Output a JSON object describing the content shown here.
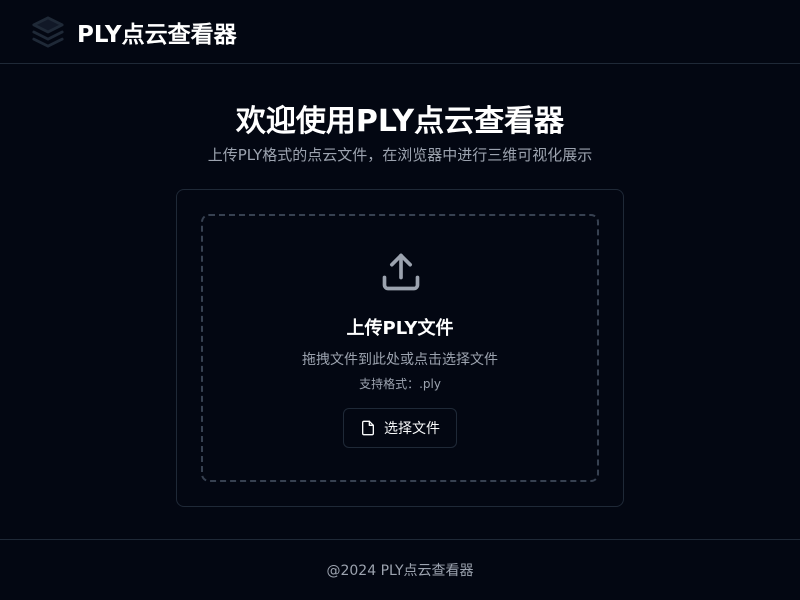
{
  "header": {
    "logo_icon": "layers-icon",
    "title": "PLY点云查看器"
  },
  "main": {
    "welcome_title": "欢迎使用PLY点云查看器",
    "welcome_subtitle": "上传PLY格式的点云文件，在浏览器中进行三维可视化展示"
  },
  "upload": {
    "icon": "upload-icon",
    "title": "上传PLY文件",
    "hint": "拖拽文件到此处或点击选择文件",
    "formats": "支持格式：.ply",
    "button_icon": "file-icon",
    "button_label": "选择文件"
  },
  "footer": {
    "text": "@2024 PLY点云查看器"
  },
  "colors": {
    "background": "#030712",
    "border": "#1f2937",
    "dashed_border": "#374151",
    "muted_text": "#9ca3af",
    "text": "#ffffff"
  }
}
